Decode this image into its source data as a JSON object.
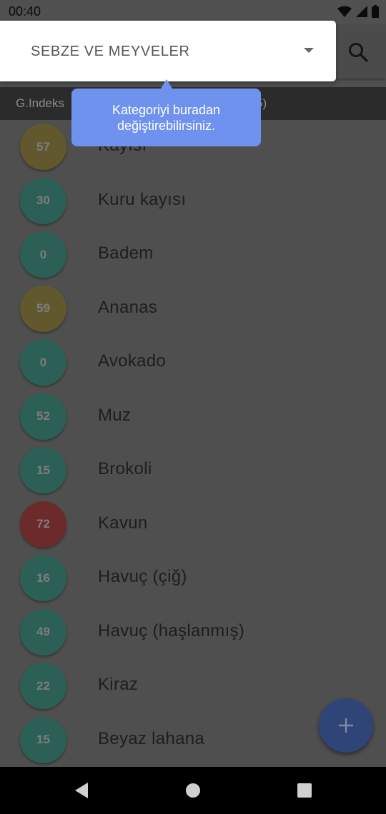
{
  "status_bar": {
    "time": "00:40",
    "icons": [
      "wifi-icon",
      "signal-icon",
      "battery-icon"
    ]
  },
  "dropdown": {
    "selected": "SEBZE VE MEYVELER"
  },
  "tooltip": {
    "line1": "Kategoriyi buradan",
    "line2": "değiştirebilirsiniz."
  },
  "header": {
    "left": "G.Indeks",
    "right": "5)"
  },
  "colors": {
    "low": "#2c5f55",
    "medium": "#62582e",
    "high": "#6c2a2a",
    "tooltip": "#6f92ef",
    "fab": "#2f4578"
  },
  "items": [
    {
      "gi": "57",
      "name": "Kayısı",
      "level": "medium"
    },
    {
      "gi": "30",
      "name": "Kuru kayısı",
      "level": "low"
    },
    {
      "gi": "0",
      "name": "Badem",
      "level": "low"
    },
    {
      "gi": "59",
      "name": "Ananas",
      "level": "medium"
    },
    {
      "gi": "0",
      "name": "Avokado",
      "level": "low"
    },
    {
      "gi": "52",
      "name": "Muz",
      "level": "low"
    },
    {
      "gi": "15",
      "name": "Brokoli",
      "level": "low"
    },
    {
      "gi": "72",
      "name": "Kavun",
      "level": "high"
    },
    {
      "gi": "16",
      "name": "Havuç (çiğ)",
      "level": "low"
    },
    {
      "gi": "49",
      "name": "Havuç (haşlanmış)",
      "level": "low"
    },
    {
      "gi": "22",
      "name": "Kiraz",
      "level": "low"
    },
    {
      "gi": "15",
      "name": "Beyaz lahana",
      "level": "low"
    }
  ],
  "fab": {
    "icon": "plus-icon"
  },
  "nav": {
    "icons": [
      "back-icon",
      "home-icon",
      "recents-icon"
    ]
  }
}
